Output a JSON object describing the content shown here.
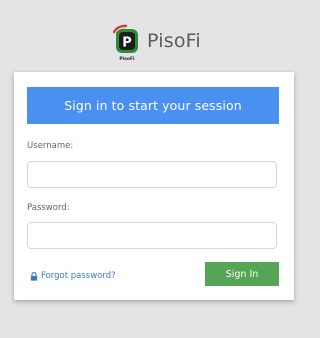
{
  "brand": {
    "name": "PisoFi",
    "logo_caption": "PisoFi",
    "logo_letter": "P",
    "logo_icon": "wifi-coin-logo"
  },
  "login": {
    "header": "Sign in to start your session",
    "username_label": "Username:",
    "username_value": "",
    "password_label": "Password:",
    "password_value": "",
    "forgot_label": "Forgot password?",
    "forgot_icon": "lock-icon",
    "signin_label": "Sign In"
  },
  "colors": {
    "header_bg": "#4a90f0",
    "signin_bg": "#56a556",
    "link": "#3b78c9",
    "logo_red": "#d93a2f",
    "logo_green": "#2e8b3a",
    "page_bg": "#e4e4e7"
  }
}
